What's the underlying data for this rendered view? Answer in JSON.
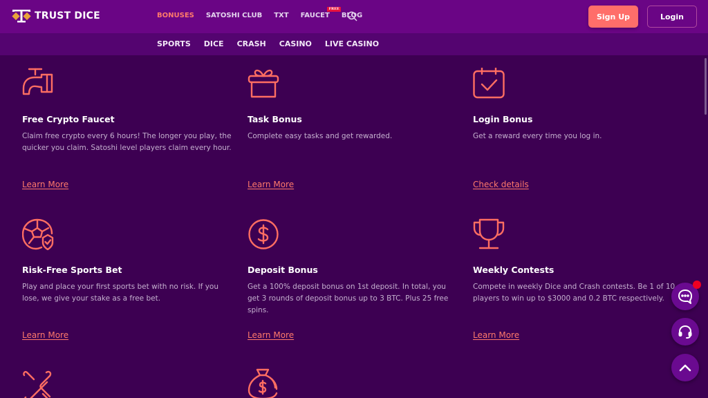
{
  "brand": {
    "name": "TRUST DICE",
    "accent_color": "#ff7a6b"
  },
  "header": {
    "nav": [
      {
        "label": "BONUSES",
        "active": true
      },
      {
        "label": "SATOSHI CLUB",
        "active": false
      },
      {
        "label": "TXT",
        "active": false
      },
      {
        "label": "FAUCET",
        "active": false,
        "badge": "FREE"
      },
      {
        "label": "BLOG",
        "active": false
      }
    ],
    "search_icon": "search-icon",
    "signup_label": "Sign Up",
    "login_label": "Login"
  },
  "subnav": [
    "SPORTS",
    "DICE",
    "CRASH",
    "CASINO",
    "LIVE CASINO"
  ],
  "cards": [
    {
      "icon": "faucet-icon",
      "title": "Free Crypto Faucet",
      "desc": "Claim free crypto every 6 hours! The longer you play, the quicker you claim. Satoshi level players claim every hour.",
      "link": "Learn More"
    },
    {
      "icon": "gift-icon",
      "title": "Task Bonus",
      "desc": "Complete easy tasks and get rewarded.",
      "link": "Learn More"
    },
    {
      "icon": "calendar-check-icon",
      "title": "Login Bonus",
      "desc": "Get a reward every time you log in.",
      "link": "Check details"
    },
    {
      "icon": "soccer-ball-shield-icon",
      "title": "Risk-Free Sports Bet",
      "desc": "Play and place your first sports bet with no risk. If you lose, we give your stake as a free bet.",
      "link": "Learn More"
    },
    {
      "icon": "dollar-circle-icon",
      "title": "Deposit Bonus",
      "desc": "Get a 100% deposit bonus on 1st deposit. In total, you get 3 rounds of deposit bonus up to 3 BTC. Plus 25 free spins.",
      "link": "Learn More"
    },
    {
      "icon": "trophy-icon",
      "title": "Weekly Contests",
      "desc": "Compete in weekly Dice and Crash contests. Be 1 of 10 players to win up to $3000 and 0.2 BTC respectively.",
      "link": "Learn More"
    }
  ],
  "partial_icons": [
    "multiplier-x-icon",
    "money-bag-icon"
  ],
  "floating": {
    "chat_icon": "chat-icon",
    "support_icon": "headset-icon",
    "top_icon": "chevron-up-icon"
  }
}
